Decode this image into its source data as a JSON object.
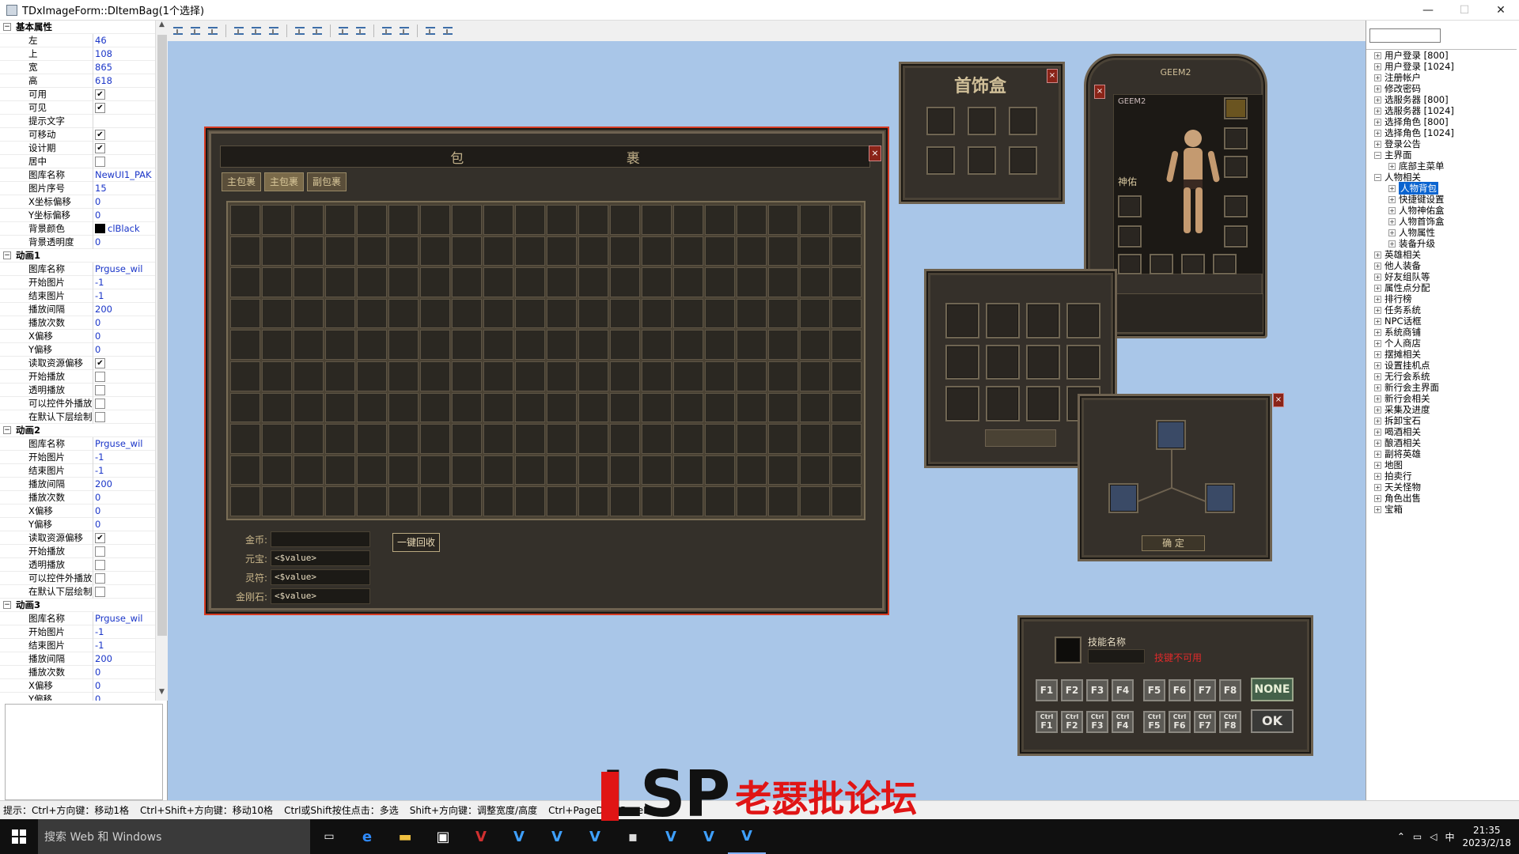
{
  "window": {
    "title": "TDxImageForm::DItemBag(1个选择)",
    "min": "—",
    "max": "☐",
    "close": "✕"
  },
  "props": [
    {
      "type": "group",
      "label": "基本属性"
    },
    {
      "type": "row",
      "name": "左",
      "value": "46"
    },
    {
      "type": "row",
      "name": "上",
      "value": "108"
    },
    {
      "type": "row",
      "name": "宽",
      "value": "865"
    },
    {
      "type": "row",
      "name": "高",
      "value": "618"
    },
    {
      "type": "check",
      "name": "可用",
      "checked": true
    },
    {
      "type": "check",
      "name": "可见",
      "checked": true
    },
    {
      "type": "row",
      "name": "提示文字",
      "value": ""
    },
    {
      "type": "check",
      "name": "可移动",
      "checked": true
    },
    {
      "type": "check",
      "name": "设计期",
      "checked": true
    },
    {
      "type": "check",
      "name": "居中",
      "checked": false
    },
    {
      "type": "row",
      "name": "图库名称",
      "value": "NewUI1_PAK"
    },
    {
      "type": "row",
      "name": "图片序号",
      "value": "15"
    },
    {
      "type": "row",
      "name": "X坐标偏移",
      "value": "0"
    },
    {
      "type": "row",
      "name": "Y坐标偏移",
      "value": "0"
    },
    {
      "type": "color",
      "name": "背景颜色",
      "value": "clBlack"
    },
    {
      "type": "row",
      "name": "背景透明度",
      "value": "0"
    },
    {
      "type": "group",
      "label": "动画1"
    },
    {
      "type": "row",
      "name": "图库名称",
      "value": "Prguse_wil"
    },
    {
      "type": "row",
      "name": "开始图片",
      "value": "-1"
    },
    {
      "type": "row",
      "name": "结束图片",
      "value": "-1"
    },
    {
      "type": "row",
      "name": "播放间隔",
      "value": "200"
    },
    {
      "type": "row",
      "name": "播放次数",
      "value": "0"
    },
    {
      "type": "row",
      "name": "X偏移",
      "value": "0"
    },
    {
      "type": "row",
      "name": "Y偏移",
      "value": "0"
    },
    {
      "type": "check",
      "name": "读取资源偏移",
      "checked": true
    },
    {
      "type": "check",
      "name": "开始播放",
      "checked": false
    },
    {
      "type": "check",
      "name": "透明播放",
      "checked": false
    },
    {
      "type": "check",
      "name": "可以控件外播放",
      "checked": false
    },
    {
      "type": "check",
      "name": "在默认下层绘制",
      "checked": false
    },
    {
      "type": "group",
      "label": "动画2"
    },
    {
      "type": "row",
      "name": "图库名称",
      "value": "Prguse_wil"
    },
    {
      "type": "row",
      "name": "开始图片",
      "value": "-1"
    },
    {
      "type": "row",
      "name": "结束图片",
      "value": "-1"
    },
    {
      "type": "row",
      "name": "播放间隔",
      "value": "200"
    },
    {
      "type": "row",
      "name": "播放次数",
      "value": "0"
    },
    {
      "type": "row",
      "name": "X偏移",
      "value": "0"
    },
    {
      "type": "row",
      "name": "Y偏移",
      "value": "0"
    },
    {
      "type": "check",
      "name": "读取资源偏移",
      "checked": true
    },
    {
      "type": "check",
      "name": "开始播放",
      "checked": false
    },
    {
      "type": "check",
      "name": "透明播放",
      "checked": false
    },
    {
      "type": "check",
      "name": "可以控件外播放",
      "checked": false
    },
    {
      "type": "check",
      "name": "在默认下层绘制",
      "checked": false
    },
    {
      "type": "group",
      "label": "动画3"
    },
    {
      "type": "row",
      "name": "图库名称",
      "value": "Prguse_wil"
    },
    {
      "type": "row",
      "name": "开始图片",
      "value": "-1"
    },
    {
      "type": "row",
      "name": "结束图片",
      "value": "-1"
    },
    {
      "type": "row",
      "name": "播放间隔",
      "value": "200"
    },
    {
      "type": "row",
      "name": "播放次数",
      "value": "0"
    },
    {
      "type": "row",
      "name": "X偏移",
      "value": "0"
    },
    {
      "type": "row",
      "name": "Y偏移",
      "value": "0"
    }
  ],
  "tree": [
    {
      "label": "用户登录 [800]",
      "level": 0,
      "exp": "+"
    },
    {
      "label": "用户登录 [1024]",
      "level": 0,
      "exp": "+"
    },
    {
      "label": "注册帐户",
      "level": 0,
      "exp": "+"
    },
    {
      "label": "修改密码",
      "level": 0,
      "exp": "+"
    },
    {
      "label": "选服务器 [800]",
      "level": 0,
      "exp": "+"
    },
    {
      "label": "选服务器 [1024]",
      "level": 0,
      "exp": "+"
    },
    {
      "label": "选择角色 [800]",
      "level": 0,
      "exp": "+"
    },
    {
      "label": "选择角色 [1024]",
      "level": 0,
      "exp": "+"
    },
    {
      "label": "登录公告",
      "level": 0,
      "exp": "+"
    },
    {
      "label": "主界面",
      "level": 0,
      "exp": "−"
    },
    {
      "label": "底部主菜单",
      "level": 1,
      "exp": "+"
    },
    {
      "label": "人物相关",
      "level": 0,
      "exp": "−"
    },
    {
      "label": "人物背包",
      "level": 1,
      "exp": "+",
      "selected": true
    },
    {
      "label": "快捷键设置",
      "level": 1,
      "exp": "+"
    },
    {
      "label": "人物神佑盒",
      "level": 1,
      "exp": "+"
    },
    {
      "label": "人物首饰盒",
      "level": 1,
      "exp": "+"
    },
    {
      "label": "人物属性",
      "level": 1,
      "exp": "+"
    },
    {
      "label": "装备升级",
      "level": 1,
      "exp": "+"
    },
    {
      "label": "英雄相关",
      "level": 0,
      "exp": "+"
    },
    {
      "label": "他人装备",
      "level": 0,
      "exp": "+"
    },
    {
      "label": "好友组队等",
      "level": 0,
      "exp": "+"
    },
    {
      "label": "属性点分配",
      "level": 0,
      "exp": "+"
    },
    {
      "label": "排行榜",
      "level": 0,
      "exp": "+"
    },
    {
      "label": "任务系统",
      "level": 0,
      "exp": "+"
    },
    {
      "label": "NPC话框",
      "level": 0,
      "exp": "+"
    },
    {
      "label": "系统商铺",
      "level": 0,
      "exp": "+"
    },
    {
      "label": "个人商店",
      "level": 0,
      "exp": "+"
    },
    {
      "label": "摆摊相关",
      "level": 0,
      "exp": "+"
    },
    {
      "label": "设置挂机点",
      "level": 0,
      "exp": "+"
    },
    {
      "label": "无行会系统",
      "level": 0,
      "exp": "+"
    },
    {
      "label": "新行会主界面",
      "level": 0,
      "exp": "+"
    },
    {
      "label": "新行会相关",
      "level": 0,
      "exp": "+"
    },
    {
      "label": "采集及进度",
      "level": 0,
      "exp": "+"
    },
    {
      "label": "拆卸宝石",
      "level": 0,
      "exp": "+"
    },
    {
      "label": "喝酒相关",
      "level": 0,
      "exp": "+"
    },
    {
      "label": "酿酒相关",
      "level": 0,
      "exp": "+"
    },
    {
      "label": "副将英雄",
      "level": 0,
      "exp": "+"
    },
    {
      "label": "地图",
      "level": 0,
      "exp": "+"
    },
    {
      "label": "拍卖行",
      "level": 0,
      "exp": "+"
    },
    {
      "label": "天关怪物",
      "level": 0,
      "exp": "+"
    },
    {
      "label": "角色出售",
      "level": 0,
      "exp": "+"
    },
    {
      "label": "宝箱",
      "level": 0,
      "exp": "+"
    }
  ],
  "bag": {
    "title": "包 裹",
    "close": "×",
    "tabs": [
      "主包裹",
      "主包裹",
      "副包裹"
    ],
    "gold_label": "金币:",
    "gold_value": "",
    "yuanbao_label": "元宝:",
    "yuanbao_value": "<$value>",
    "lingfu_label": "灵符:",
    "lingfu_value": "<$value>",
    "diamond_label": "金刚石:",
    "diamond_value": "<$value>",
    "recycle_button": "一键回收"
  },
  "jewel_box": {
    "title": "首饰盒",
    "close": "×"
  },
  "char_panel": {
    "name_top": "GEEM2",
    "name_inner": "GEEM2",
    "shenyou": "神佑",
    "close": "×"
  },
  "rune_panel": {
    "confirm": "确 定",
    "close": "×"
  },
  "skill_panel": {
    "skill_name": "技能名称",
    "unavailable": "技键不可用",
    "fkeys": [
      "F1",
      "F2",
      "F3",
      "F4",
      "F5",
      "F6",
      "F7",
      "F8"
    ],
    "ctrl_prefix": "Ctrl",
    "none_button": "NONE",
    "ok_button": "OK"
  },
  "status": {
    "hints": [
      "提示：Ctrl+方向键：移动1格",
      "Ctrl+Shift+方向键：移动10格",
      "Ctrl或Shift按住点击：多选",
      "Shift+方向键：调整宽度/高度",
      "Ctrl+PageDo",
      "PageDo"
    ]
  },
  "taskbar": {
    "search_placeholder": "搜索 Web 和 Windows",
    "apps": [
      "task-view",
      "edge",
      "explorer",
      "store",
      "app-v1",
      "app-v2",
      "app-v3",
      "app-v4",
      "app-v5",
      "app-v6",
      "app-v7",
      "app-v8"
    ],
    "time": "21:35",
    "date": "2023/2/18",
    "ime": "中"
  },
  "watermark": {
    "brand": "LSP",
    "text": "老瑟批论坛"
  }
}
